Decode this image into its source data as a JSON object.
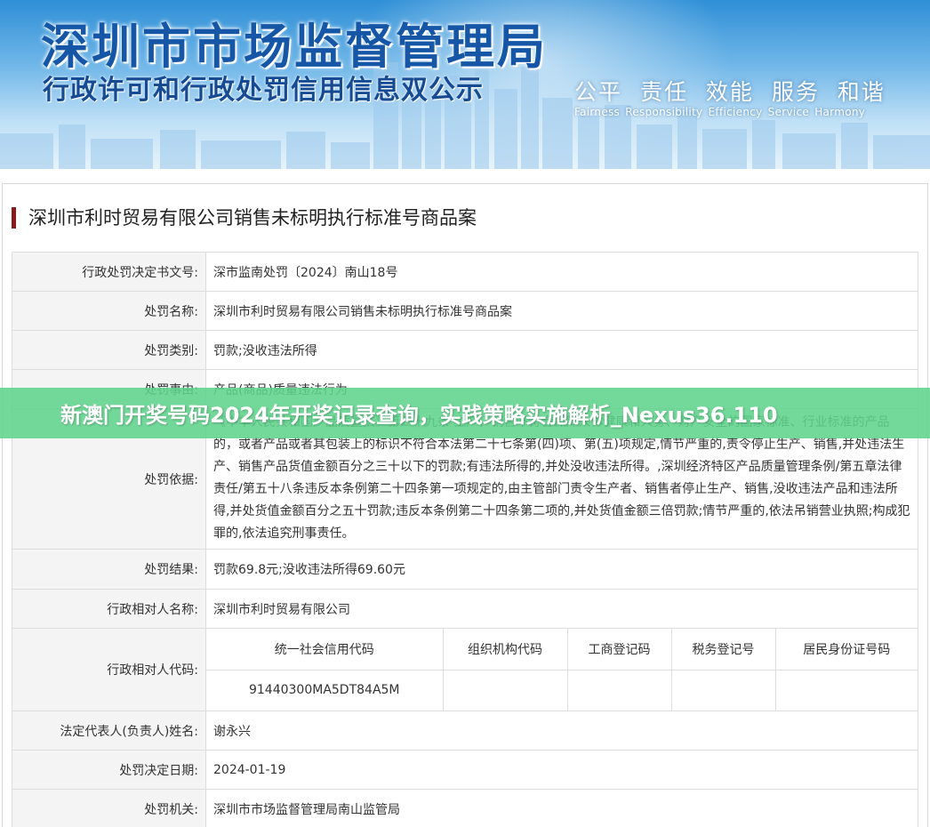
{
  "banner": {
    "title": "深圳市市场监督管理局",
    "subtitle": "行政许可和行政处罚信用信息双公示",
    "motto_cn": "公平 责任 效能 服务 和谐",
    "motto_en": "Fairness Responsibility Efficiency Service Harmony"
  },
  "case": {
    "title": "深圳市利时贸易有限公司销售未标明执行标准号商品案"
  },
  "rows": {
    "doc_number": {
      "label": "行政处罚决定书文号:",
      "value": "深市监南处罚〔2024〕南山18号"
    },
    "case_name": {
      "label": "处罚名称:",
      "value": "深圳市利时贸易有限公司销售未标明执行标准号商品案"
    },
    "category": {
      "label": "处罚类别:",
      "value": "罚款;没收违法所得"
    },
    "reason": {
      "label": "处罚事由:",
      "value": "产品(商品)质量违法行为"
    },
    "basis": {
      "label": "处罚依据:",
      "value": "《中华人民共和国产品质量法》第四十九条 生产、销售不符合保障人体健康和人身、财产安全的国家标准、行业标准的产品的，或者产品或者其包装上的标识不符合本法第二十七条第(四)项、第(五)项规定,情节严重的,责令停止生产、销售,并处违法生产、销售产品货值金额百分之三十以下的罚款;有违法所得的,并处没收违法所得。,深圳经济特区产品质量管理条例/第五章法律责任/第五十八条违反本条例第二十四条第一项规定的,由主管部门责令生产者、销售者停止生产、销售,没收违法产品和违法所得,并处货值金额百分之五十罚款;违反本条例第二十四条第二项的,并处货值金额三倍罚款;情节严重的,依法吊销营业执照;构成犯罪的,依法追究刑事责任。"
    },
    "result": {
      "label": "处罚结果:",
      "value": "罚款69.8元;没收违法所得69.60元"
    },
    "party_name": {
      "label": "行政相对人名称:",
      "value": "深圳市利时贸易有限公司"
    },
    "party_code": {
      "label": "行政相对人代码:",
      "headers": [
        "统一社会信用代码",
        "组织机构代码",
        "工商登记码",
        "税务登记号",
        "居民身份证号码"
      ],
      "values": [
        "91440300MA5DT84A5M",
        "",
        "",
        "",
        ""
      ]
    },
    "legal_rep": {
      "label": "法定代表人(负责人)姓名:",
      "value": "谢永兴"
    },
    "date": {
      "label": "处罚决定日期:",
      "value": "2024-01-19"
    },
    "authority": {
      "label": "处罚机关:",
      "value": "深圳市市场监督管理局南山监管局"
    }
  },
  "overlay": {
    "text": "新澳门开奖号码2024年开奖记录查询，实践策略实施解析_Nexus36.110"
  },
  "colors": {
    "title_bar": "#8b1a1a",
    "label_bg": "#f4f4f4",
    "overlay_band": "#60d48c",
    "banner_blue": "#1556a6"
  }
}
